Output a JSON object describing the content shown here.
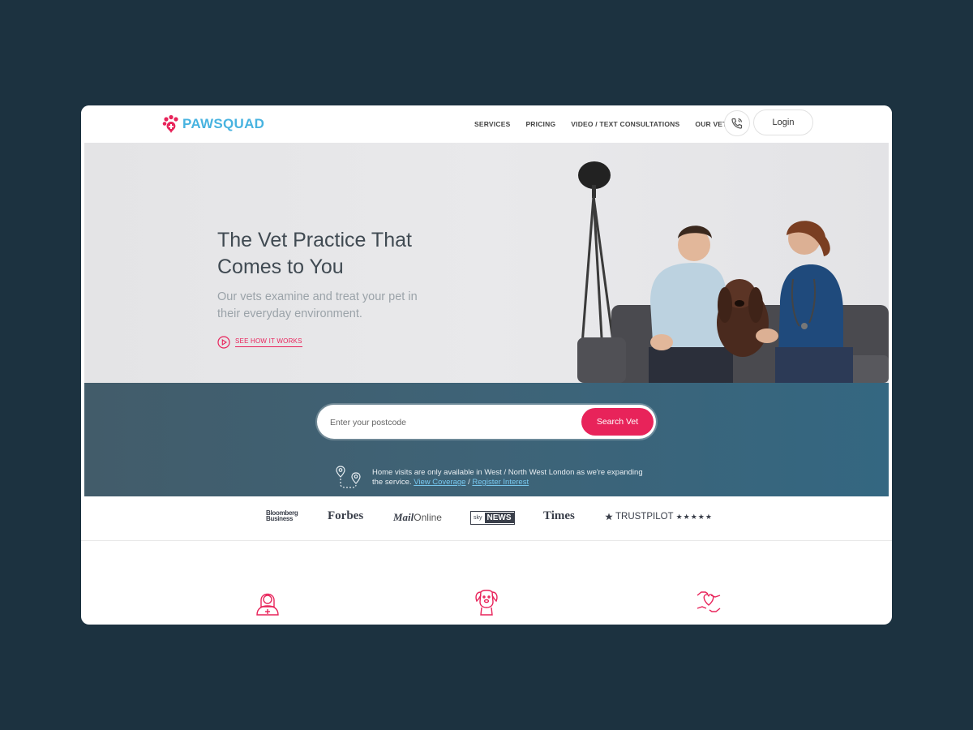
{
  "header": {
    "logo_text": "PAWSQUAD",
    "nav": [
      "SERVICES",
      "PRICING",
      "VIDEO / TEXT CONSULTATIONS",
      "OUR VETS"
    ],
    "login_label": "Login"
  },
  "hero": {
    "title_line1": "The Vet Practice That",
    "title_line2": "Comes to You",
    "subtitle": "Our vets examine and treat your pet in their everyday environment.",
    "how_it_works_label": "SEE HOW IT WORKS"
  },
  "search": {
    "placeholder": "Enter your postcode",
    "button_label": "Search Vet",
    "coverage_text": "Home visits are only available in West / North West London as we're expanding the service.",
    "coverage_link": "View Coverage",
    "separator": "/",
    "register_link": "Register Interest"
  },
  "press": {
    "bloomberg_line1": "Bloomberg",
    "bloomberg_line2": "Business",
    "forbes": "Forbes",
    "mail_bold": "Mail",
    "mail_rest": "Online",
    "sky": "sky",
    "news": "NEWS",
    "times": "Times",
    "trustpilot": "TRUSTPILOT",
    "trustpilot_stars": "★★★★★"
  },
  "colors": {
    "background": "#1c3240",
    "accent": "#e8235a",
    "logo_blue": "#48b3e0",
    "band": "#3e6377"
  },
  "icons": [
    "paw-logo-icon",
    "phone-icon",
    "play-circle-icon",
    "map-pins-icon",
    "vet-person-icon",
    "dog-icon",
    "heart-hands-icon",
    "trustpilot-star-icon"
  ]
}
